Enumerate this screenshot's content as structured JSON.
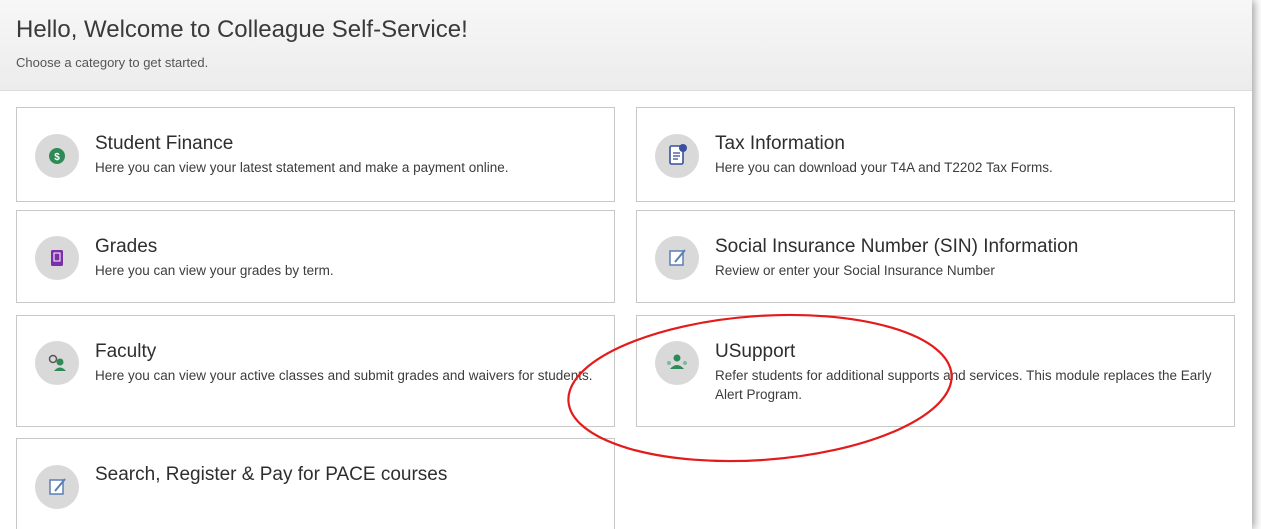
{
  "header": {
    "title": "Hello, Welcome to Colleague Self-Service!",
    "subtitle": "Choose a category to get started."
  },
  "tiles": [
    {
      "title": "Student Finance",
      "description": "Here you can view your latest statement and make a payment online.",
      "icon": "dollar-coin-icon"
    },
    {
      "title": "Tax Information",
      "description": "Here you can download your T4A and T2202 Tax Forms.",
      "icon": "tax-document-icon"
    },
    {
      "title": "Grades",
      "description": "Here you can view your grades by term.",
      "icon": "grade-book-icon"
    },
    {
      "title": "Social Insurance Number (SIN) Information",
      "description": "Review or enter your Social Insurance Number",
      "icon": "edit-form-icon"
    },
    {
      "title": "Faculty",
      "description": "Here you can view your active classes and submit grades and waivers for students.",
      "icon": "faculty-users-icon"
    },
    {
      "title": "USupport",
      "description": "Refer students for additional supports and services. This module replaces the Early Alert Program.",
      "icon": "support-people-icon"
    },
    {
      "title": "Search, Register & Pay for PACE courses",
      "description": "",
      "icon": "edit-form-icon"
    }
  ],
  "colors": {
    "annotation_circle": "#e31b1b",
    "icon_background": "#d9d9d9",
    "finance_icon": "#2e8b57",
    "grades_icon": "#7b2fa8",
    "tax_icon": "#3a4fa0",
    "support_icon": "#2e8b57",
    "form_icon": "#5a7fb5"
  }
}
